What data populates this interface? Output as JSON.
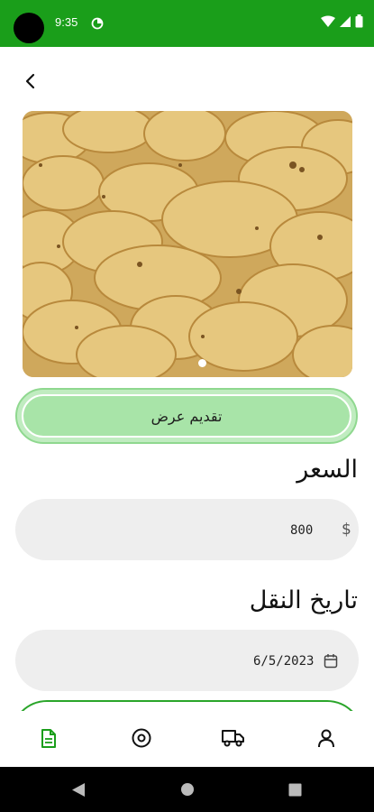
{
  "status_bar": {
    "time": "9:35"
  },
  "price": {
    "label": "السعر",
    "currency_symbol": "$",
    "value": "800"
  },
  "transport_date": {
    "label": "تاريخ النقل",
    "value": "6/5/2023"
  },
  "offer_button_label": "تقديم عرض",
  "bottom_nav": {
    "items": [
      {
        "icon": "document-icon",
        "active": true
      },
      {
        "icon": "target-icon",
        "active": false
      },
      {
        "icon": "truck-icon",
        "active": false
      },
      {
        "icon": "user-icon",
        "active": false
      }
    ]
  },
  "colors": {
    "brand": "#1a9e1a",
    "offer_button": "#a8e4a8",
    "field_bg": "#eeeeee"
  }
}
